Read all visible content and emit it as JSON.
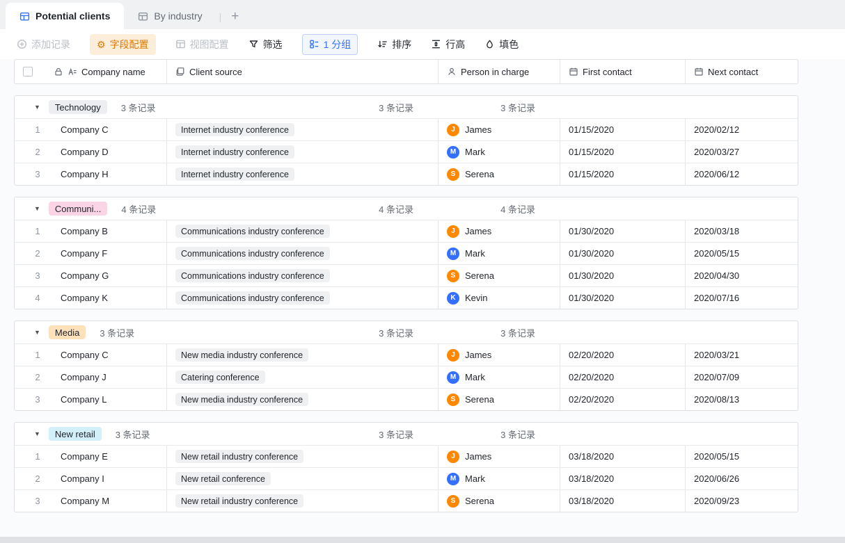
{
  "tabs": [
    {
      "label": "Potential clients",
      "active": true
    },
    {
      "label": "By industry",
      "active": false
    }
  ],
  "tabbar": {
    "add_tab_label": "+",
    "divider": "|"
  },
  "toolbar": {
    "add_record": "添加记录",
    "field_config": "字段配置",
    "view_config": "视图配置",
    "filter": "筛选",
    "group": "1 分组",
    "sort": "排序",
    "row_height": "行高",
    "fill_color": "填色"
  },
  "table": {
    "columns": {
      "company_name": "Company name",
      "client_source": "Client source",
      "person_in_charge": "Person in charge",
      "first_contact": "First contact",
      "next_contact": "Next contact"
    }
  },
  "colors": {
    "accent_blue": "#3370ff",
    "accent_orange": "#de7802",
    "avatar_orange": "#ff8800",
    "avatar_blue": "#3370ff"
  },
  "groups": [
    {
      "name": "Technology",
      "badge_color": "#eceef1",
      "count": "3 条记录",
      "rows": [
        {
          "num": "1",
          "company": "Company C",
          "source": "Internet industry conference",
          "person": "James",
          "avatar": "J",
          "avatar_color": "#ff8800",
          "first": "01/15/2020",
          "next": "2020/02/12"
        },
        {
          "num": "2",
          "company": "Company D",
          "source": "Internet industry conference",
          "person": "Mark",
          "avatar": "M",
          "avatar_color": "#3370ff",
          "first": "01/15/2020",
          "next": "2020/03/27"
        },
        {
          "num": "3",
          "company": "Company H",
          "source": "Internet industry conference",
          "person": "Serena",
          "avatar": "S",
          "avatar_color": "#ff8800",
          "first": "01/15/2020",
          "next": "2020/06/12"
        }
      ]
    },
    {
      "name": "Communi...",
      "badge_color": "#fbd5e5",
      "count": "4 条记录",
      "rows": [
        {
          "num": "1",
          "company": "Company B",
          "source": "Communications industry conference",
          "person": "James",
          "avatar": "J",
          "avatar_color": "#ff8800",
          "first": "01/30/2020",
          "next": "2020/03/18"
        },
        {
          "num": "2",
          "company": "Company F",
          "source": "Communications industry conference",
          "person": "Mark",
          "avatar": "M",
          "avatar_color": "#3370ff",
          "first": "01/30/2020",
          "next": "2020/05/15"
        },
        {
          "num": "3",
          "company": "Company G",
          "source": "Communications industry conference",
          "person": "Serena",
          "avatar": "S",
          "avatar_color": "#ff8800",
          "first": "01/30/2020",
          "next": "2020/04/30"
        },
        {
          "num": "4",
          "company": "Company K",
          "source": "Communications industry conference",
          "person": "Kevin",
          "avatar": "K",
          "avatar_color": "#3370ff",
          "first": "01/30/2020",
          "next": "2020/07/16"
        }
      ]
    },
    {
      "name": "Media",
      "badge_color": "#fce1ba",
      "count": "3 条记录",
      "rows": [
        {
          "num": "1",
          "company": "Company C",
          "source": "New media industry conference",
          "person": "James",
          "avatar": "J",
          "avatar_color": "#ff8800",
          "first": "02/20/2020",
          "next": "2020/03/21"
        },
        {
          "num": "2",
          "company": "Company J",
          "source": "Catering conference",
          "person": "Mark",
          "avatar": "M",
          "avatar_color": "#3370ff",
          "first": "02/20/2020",
          "next": "2020/07/09"
        },
        {
          "num": "3",
          "company": "Company L",
          "source": "New media industry conference",
          "person": "Serena",
          "avatar": "S",
          "avatar_color": "#ff8800",
          "first": "02/20/2020",
          "next": "2020/08/13"
        }
      ]
    },
    {
      "name": "New retail",
      "badge_color": "#d3f0fa",
      "count": "3 条记录",
      "rows": [
        {
          "num": "1",
          "company": "Company E",
          "source": "New retail industry conference",
          "person": "James",
          "avatar": "J",
          "avatar_color": "#ff8800",
          "first": "03/18/2020",
          "next": "2020/05/15"
        },
        {
          "num": "2",
          "company": "Company I",
          "source": "New retail conference",
          "person": "Mark",
          "avatar": "M",
          "avatar_color": "#3370ff",
          "first": "03/18/2020",
          "next": "2020/06/26"
        },
        {
          "num": "3",
          "company": "Company M",
          "source": "New retail industry conference",
          "person": "Serena",
          "avatar": "S",
          "avatar_color": "#ff8800",
          "first": "03/18/2020",
          "next": "2020/09/23"
        }
      ]
    }
  ]
}
